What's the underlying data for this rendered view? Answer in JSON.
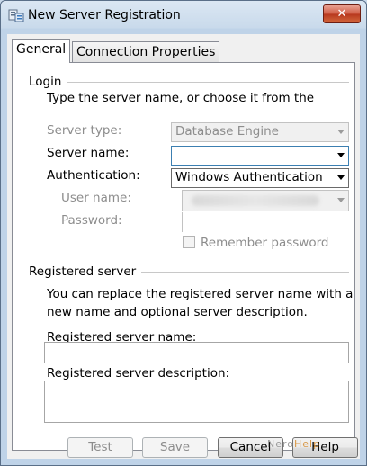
{
  "window": {
    "title": "New Server Registration",
    "close_label": "✕"
  },
  "tabs": [
    {
      "label": "General",
      "active": true
    },
    {
      "label": "Connection Properties",
      "active": false
    }
  ],
  "login": {
    "group_label": "Login",
    "instruction": "Type the server name, or choose it from the",
    "server_type_label": "Server type:",
    "server_type_value": "Database Engine",
    "server_name_label": "Server name:",
    "server_name_value": "",
    "authentication_label": "Authentication:",
    "authentication_value": "Windows Authentication",
    "user_name_label": "User name:",
    "password_label": "Password:",
    "remember_password_label": "Remember password"
  },
  "registered": {
    "group_label": "Registered server",
    "description_line1": "You can replace the registered server name with a",
    "description_line2": "new name and optional server description.",
    "name_label": "Registered server name:",
    "name_value": "",
    "description_label": "Registered server description:",
    "description_value": ""
  },
  "buttons": {
    "test": "Test",
    "save": "Save",
    "cancel": "Cancel",
    "help": "Help"
  },
  "watermark": {
    "part1": "Nero",
    "part2": "Help"
  },
  "colors": {
    "title_bar": "#c9daeb",
    "close_button": "#cf5b43",
    "focus_border": "#3c7fb1"
  }
}
